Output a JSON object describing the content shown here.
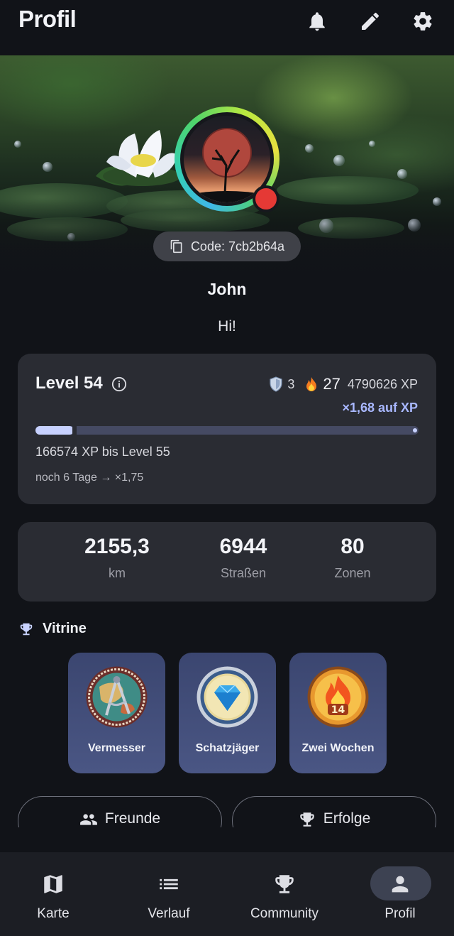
{
  "appbar": {
    "title": "Profil",
    "icons": [
      "bell-icon",
      "pencil-icon",
      "gear-icon"
    ]
  },
  "profile": {
    "code_label": "Code: 7cb2b64a",
    "name": "John",
    "bio": "Hi!",
    "status_color": "#e53935"
  },
  "level": {
    "title": "Level 54",
    "shield_count": "3",
    "streak_count": "27",
    "xp_total": "4790626 XP",
    "multiplier": "×1,68 auf XP",
    "progress_fraction": 0.1,
    "xp_to_next": "166574 XP bis Level 55",
    "boost_note": "noch 6 Tage → ×1,75"
  },
  "stats": [
    {
      "value": "2155,3",
      "label": "km"
    },
    {
      "value": "6944",
      "label": "Straßen"
    },
    {
      "value": "80",
      "label": "Zonen"
    }
  ],
  "showcase": {
    "title": "Vitrine",
    "badges": [
      {
        "label": "Vermesser",
        "icon": "compass-medal-icon"
      },
      {
        "label": "Schatzjäger",
        "icon": "diamond-medal-icon"
      },
      {
        "label": "Zwei Wochen",
        "icon": "flame-14-medal-icon",
        "medal_number": "14"
      }
    ]
  },
  "actions": {
    "friends_label": "Freunde",
    "achievements_label": "Erfolge"
  },
  "nav": {
    "items": [
      {
        "label": "Karte",
        "icon": "map-icon"
      },
      {
        "label": "Verlauf",
        "icon": "list-icon"
      },
      {
        "label": "Community",
        "icon": "trophy-icon"
      },
      {
        "label": "Profil",
        "icon": "person-icon",
        "active": true
      }
    ]
  },
  "colors": {
    "background": "#111318",
    "card": "#2a2c33",
    "accent": "#a9b8ff",
    "badge_bg": "#3b4670"
  }
}
